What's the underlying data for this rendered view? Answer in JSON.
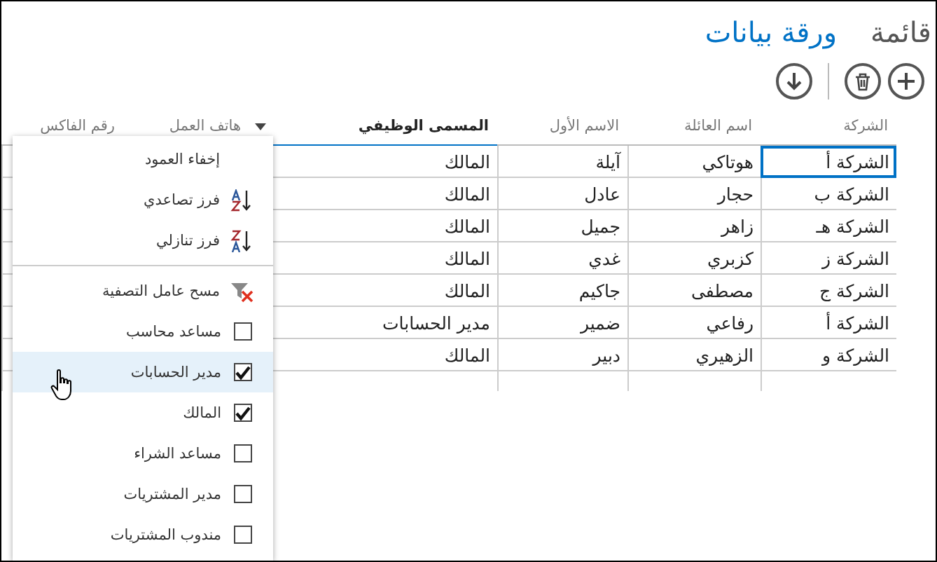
{
  "tabs": [
    {
      "label": "قائمة",
      "selected": false
    },
    {
      "label": "ورقة بيانات",
      "selected": true
    }
  ],
  "toolbar": [
    {
      "kind": "add"
    },
    {
      "kind": "delete"
    },
    {
      "kind": "separator"
    },
    {
      "kind": "download"
    }
  ],
  "columns": [
    {
      "label": "الشركة",
      "filtered": false
    },
    {
      "label": "اسم العائلة",
      "filtered": false
    },
    {
      "label": "الاسم الأول",
      "filtered": false
    },
    {
      "label": "المسمى الوظيفي",
      "filtered": true
    },
    {
      "label": "هاتف العمل",
      "filtered": false
    },
    {
      "label": "رقم الفاكس",
      "filtered": false
    }
  ],
  "rows": [
    {
      "cells": [
        "الشركة أ",
        "هوتاكي",
        "آيلة",
        "المالك"
      ],
      "selected": true
    },
    {
      "cells": [
        "الشركة ب",
        "حجار",
        "عادل",
        "المالك"
      ],
      "selected": false
    },
    {
      "cells": [
        "الشركة هـ",
        "زاهر",
        "جميل",
        "المالك"
      ],
      "selected": false
    },
    {
      "cells": [
        "الشركة ز",
        "كزبري",
        "غدي",
        "المالك"
      ],
      "selected": false
    },
    {
      "cells": [
        "الشركة ج",
        "مصطفى",
        "جاكيم",
        "المالك"
      ],
      "selected": false
    },
    {
      "cells": [
        "الشركة أ",
        "رفاعي",
        "ضمير",
        "مدير الحسابات"
      ],
      "selected": false
    },
    {
      "cells": [
        "الشركة و",
        "الزهيري",
        "دبير",
        "المالك"
      ],
      "selected": false
    }
  ],
  "menu": {
    "items": [
      {
        "kind": "plain",
        "label": "إخفاء العمود",
        "hovered": false
      },
      {
        "kind": "sort_ascending",
        "label": "فرز تصاعدي",
        "hovered": false
      },
      {
        "kind": "sort_descending",
        "label": "فرز تنازلي",
        "hovered": false
      },
      {
        "kind": "separator"
      },
      {
        "kind": "clear_filter",
        "label": "مسح عامل التصفية",
        "hovered": false
      },
      {
        "kind": "checkbox",
        "label": "مساعد محاسب",
        "checked": false,
        "hovered": false
      },
      {
        "kind": "checkbox",
        "label": "مدير الحسابات",
        "checked": true,
        "hovered": true
      },
      {
        "kind": "checkbox",
        "label": "المالك",
        "checked": true,
        "hovered": false
      },
      {
        "kind": "checkbox",
        "label": "مساعد الشراء",
        "checked": false,
        "hovered": false
      },
      {
        "kind": "checkbox",
        "label": "مدير المشتريات",
        "checked": false,
        "hovered": false
      },
      {
        "kind": "checkbox",
        "label": "مندوب المشتريات",
        "checked": false,
        "hovered": false
      }
    ]
  }
}
